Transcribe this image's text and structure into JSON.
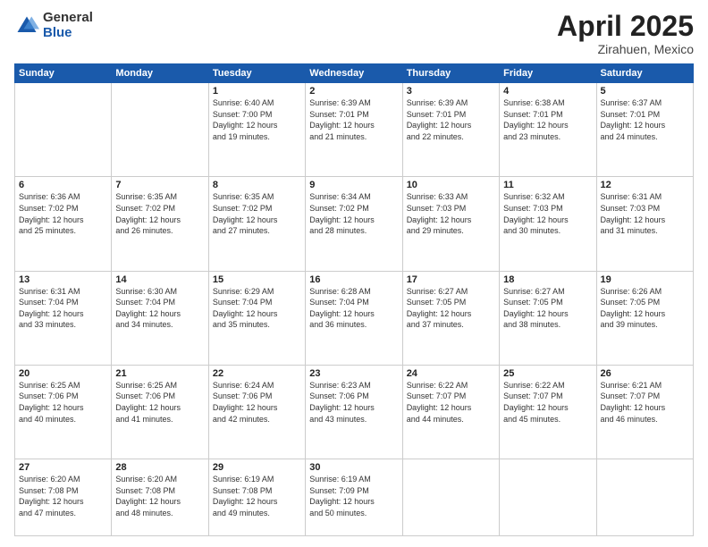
{
  "logo": {
    "general": "General",
    "blue": "Blue"
  },
  "header": {
    "month_year": "April 2025",
    "location": "Zirahuen, Mexico"
  },
  "days_of_week": [
    "Sunday",
    "Monday",
    "Tuesday",
    "Wednesday",
    "Thursday",
    "Friday",
    "Saturday"
  ],
  "weeks": [
    [
      {
        "day": "",
        "detail": ""
      },
      {
        "day": "",
        "detail": ""
      },
      {
        "day": "1",
        "detail": "Sunrise: 6:40 AM\nSunset: 7:00 PM\nDaylight: 12 hours\nand 19 minutes."
      },
      {
        "day": "2",
        "detail": "Sunrise: 6:39 AM\nSunset: 7:01 PM\nDaylight: 12 hours\nand 21 minutes."
      },
      {
        "day": "3",
        "detail": "Sunrise: 6:39 AM\nSunset: 7:01 PM\nDaylight: 12 hours\nand 22 minutes."
      },
      {
        "day": "4",
        "detail": "Sunrise: 6:38 AM\nSunset: 7:01 PM\nDaylight: 12 hours\nand 23 minutes."
      },
      {
        "day": "5",
        "detail": "Sunrise: 6:37 AM\nSunset: 7:01 PM\nDaylight: 12 hours\nand 24 minutes."
      }
    ],
    [
      {
        "day": "6",
        "detail": "Sunrise: 6:36 AM\nSunset: 7:02 PM\nDaylight: 12 hours\nand 25 minutes."
      },
      {
        "day": "7",
        "detail": "Sunrise: 6:35 AM\nSunset: 7:02 PM\nDaylight: 12 hours\nand 26 minutes."
      },
      {
        "day": "8",
        "detail": "Sunrise: 6:35 AM\nSunset: 7:02 PM\nDaylight: 12 hours\nand 27 minutes."
      },
      {
        "day": "9",
        "detail": "Sunrise: 6:34 AM\nSunset: 7:02 PM\nDaylight: 12 hours\nand 28 minutes."
      },
      {
        "day": "10",
        "detail": "Sunrise: 6:33 AM\nSunset: 7:03 PM\nDaylight: 12 hours\nand 29 minutes."
      },
      {
        "day": "11",
        "detail": "Sunrise: 6:32 AM\nSunset: 7:03 PM\nDaylight: 12 hours\nand 30 minutes."
      },
      {
        "day": "12",
        "detail": "Sunrise: 6:31 AM\nSunset: 7:03 PM\nDaylight: 12 hours\nand 31 minutes."
      }
    ],
    [
      {
        "day": "13",
        "detail": "Sunrise: 6:31 AM\nSunset: 7:04 PM\nDaylight: 12 hours\nand 33 minutes."
      },
      {
        "day": "14",
        "detail": "Sunrise: 6:30 AM\nSunset: 7:04 PM\nDaylight: 12 hours\nand 34 minutes."
      },
      {
        "day": "15",
        "detail": "Sunrise: 6:29 AM\nSunset: 7:04 PM\nDaylight: 12 hours\nand 35 minutes."
      },
      {
        "day": "16",
        "detail": "Sunrise: 6:28 AM\nSunset: 7:04 PM\nDaylight: 12 hours\nand 36 minutes."
      },
      {
        "day": "17",
        "detail": "Sunrise: 6:27 AM\nSunset: 7:05 PM\nDaylight: 12 hours\nand 37 minutes."
      },
      {
        "day": "18",
        "detail": "Sunrise: 6:27 AM\nSunset: 7:05 PM\nDaylight: 12 hours\nand 38 minutes."
      },
      {
        "day": "19",
        "detail": "Sunrise: 6:26 AM\nSunset: 7:05 PM\nDaylight: 12 hours\nand 39 minutes."
      }
    ],
    [
      {
        "day": "20",
        "detail": "Sunrise: 6:25 AM\nSunset: 7:06 PM\nDaylight: 12 hours\nand 40 minutes."
      },
      {
        "day": "21",
        "detail": "Sunrise: 6:25 AM\nSunset: 7:06 PM\nDaylight: 12 hours\nand 41 minutes."
      },
      {
        "day": "22",
        "detail": "Sunrise: 6:24 AM\nSunset: 7:06 PM\nDaylight: 12 hours\nand 42 minutes."
      },
      {
        "day": "23",
        "detail": "Sunrise: 6:23 AM\nSunset: 7:06 PM\nDaylight: 12 hours\nand 43 minutes."
      },
      {
        "day": "24",
        "detail": "Sunrise: 6:22 AM\nSunset: 7:07 PM\nDaylight: 12 hours\nand 44 minutes."
      },
      {
        "day": "25",
        "detail": "Sunrise: 6:22 AM\nSunset: 7:07 PM\nDaylight: 12 hours\nand 45 minutes."
      },
      {
        "day": "26",
        "detail": "Sunrise: 6:21 AM\nSunset: 7:07 PM\nDaylight: 12 hours\nand 46 minutes."
      }
    ],
    [
      {
        "day": "27",
        "detail": "Sunrise: 6:20 AM\nSunset: 7:08 PM\nDaylight: 12 hours\nand 47 minutes."
      },
      {
        "day": "28",
        "detail": "Sunrise: 6:20 AM\nSunset: 7:08 PM\nDaylight: 12 hours\nand 48 minutes."
      },
      {
        "day": "29",
        "detail": "Sunrise: 6:19 AM\nSunset: 7:08 PM\nDaylight: 12 hours\nand 49 minutes."
      },
      {
        "day": "30",
        "detail": "Sunrise: 6:19 AM\nSunset: 7:09 PM\nDaylight: 12 hours\nand 50 minutes."
      },
      {
        "day": "",
        "detail": ""
      },
      {
        "day": "",
        "detail": ""
      },
      {
        "day": "",
        "detail": ""
      }
    ]
  ]
}
